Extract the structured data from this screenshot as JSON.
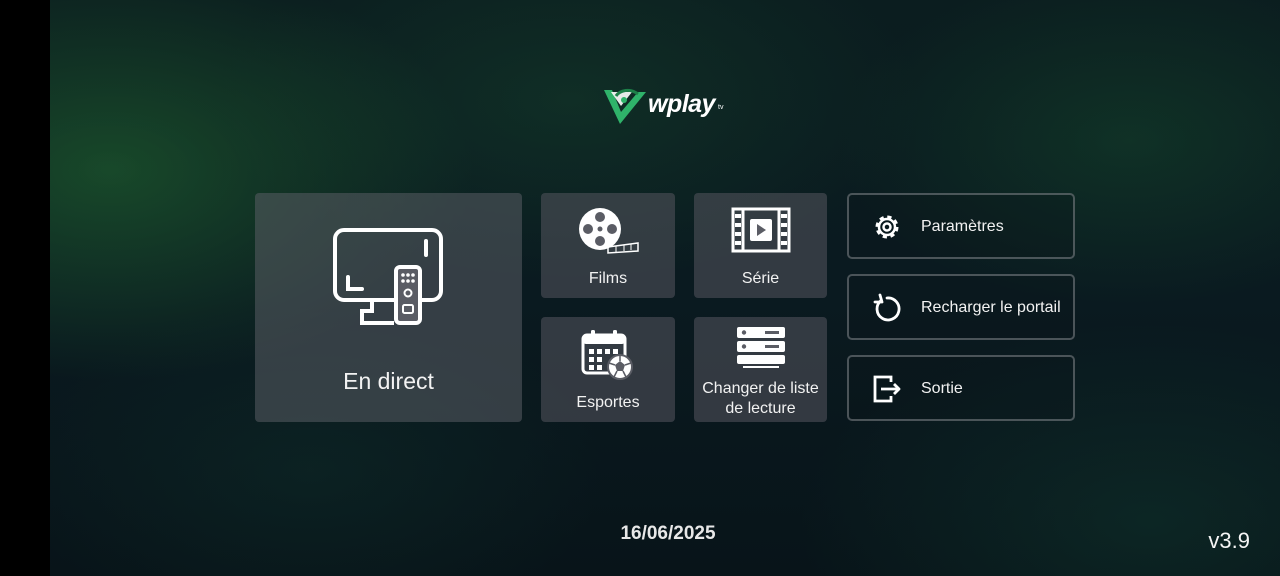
{
  "brand": {
    "name": "wplay",
    "suffix": "tv",
    "accent_color": "#2fb36a"
  },
  "tiles": {
    "live": {
      "label": "En direct",
      "icon": "tv-remote-icon"
    },
    "films": {
      "label": "Films",
      "icon": "film-reel-icon"
    },
    "serie": {
      "label": "Série",
      "icon": "film-strip-play-icon"
    },
    "sports": {
      "label": "Esportes",
      "icon": "calendar-soccer-icon"
    },
    "playlist": {
      "label_line1": "Changer de liste",
      "label_line2": "de lecture",
      "icon": "server-list-icon"
    }
  },
  "side_buttons": {
    "settings": {
      "label": "Paramètres",
      "icon": "gear-icon"
    },
    "reload": {
      "label": "Recharger le portail",
      "icon": "reload-icon"
    },
    "exit": {
      "label": "Sortie",
      "icon": "exit-icon"
    }
  },
  "footer": {
    "date": "16/06/2025",
    "version": "v3.9"
  }
}
